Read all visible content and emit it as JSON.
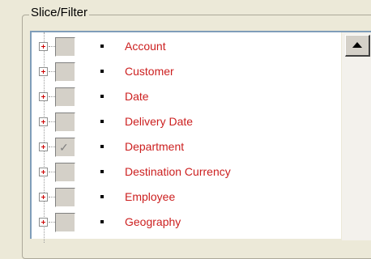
{
  "panel": {
    "title": "Slice/Filter",
    "items": [
      {
        "label": "Account",
        "checked": false
      },
      {
        "label": "Customer",
        "checked": false
      },
      {
        "label": "Date",
        "checked": false
      },
      {
        "label": "Delivery Date",
        "checked": false
      },
      {
        "label": "Department",
        "checked": true,
        "check_glyph": "✓"
      },
      {
        "label": "Destination Currency",
        "checked": false
      },
      {
        "label": "Employee",
        "checked": false
      },
      {
        "label": "Geography",
        "checked": false
      }
    ]
  },
  "colors": {
    "label_text": "#cc1f1f",
    "background": "#ece9d8",
    "tree_background": "#ffffff"
  },
  "icons": {
    "expander": "plus-box-icon",
    "scroll_up": "arrow-up-icon"
  }
}
